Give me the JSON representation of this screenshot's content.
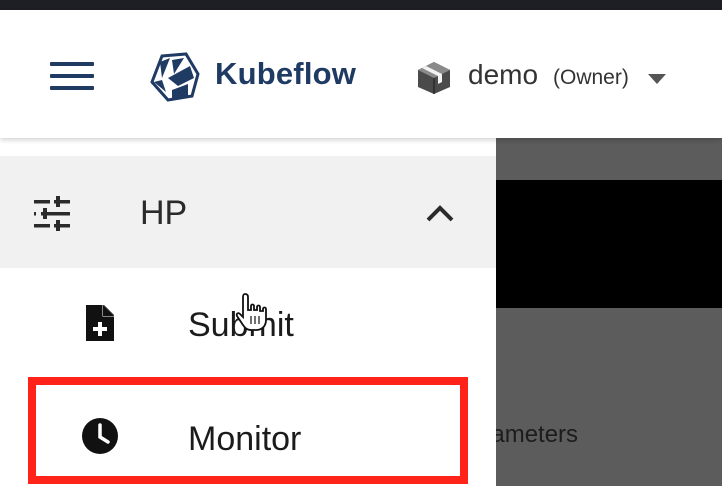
{
  "colors": {
    "brand": "#1f3a63",
    "highlight": "#ff2319",
    "group_bg": "#f1f1f1",
    "overlay": "#5c5c5c"
  },
  "header": {
    "menu_icon": "hamburger-menu-icon",
    "logo_icon": "kubeflow-logo-icon",
    "app_name": "Kubeflow",
    "namespace": {
      "icon": "cube-box-icon",
      "name": "demo",
      "role": "(Owner)",
      "caret_icon": "caret-down-icon"
    }
  },
  "sidebar": {
    "group": {
      "icon": "tune-sliders-icon",
      "label": "HP",
      "expand_icon": "chevron-up-icon"
    },
    "items": [
      {
        "label": "Submit",
        "icon": "add-document-icon"
      },
      {
        "label": "Monitor",
        "icon": "clock-icon"
      }
    ]
  },
  "content": {
    "partial_text": "Parameters"
  },
  "annotation": {
    "highlighted_item": "Monitor"
  },
  "pointer": {
    "icon": "hand-pointer-icon"
  }
}
